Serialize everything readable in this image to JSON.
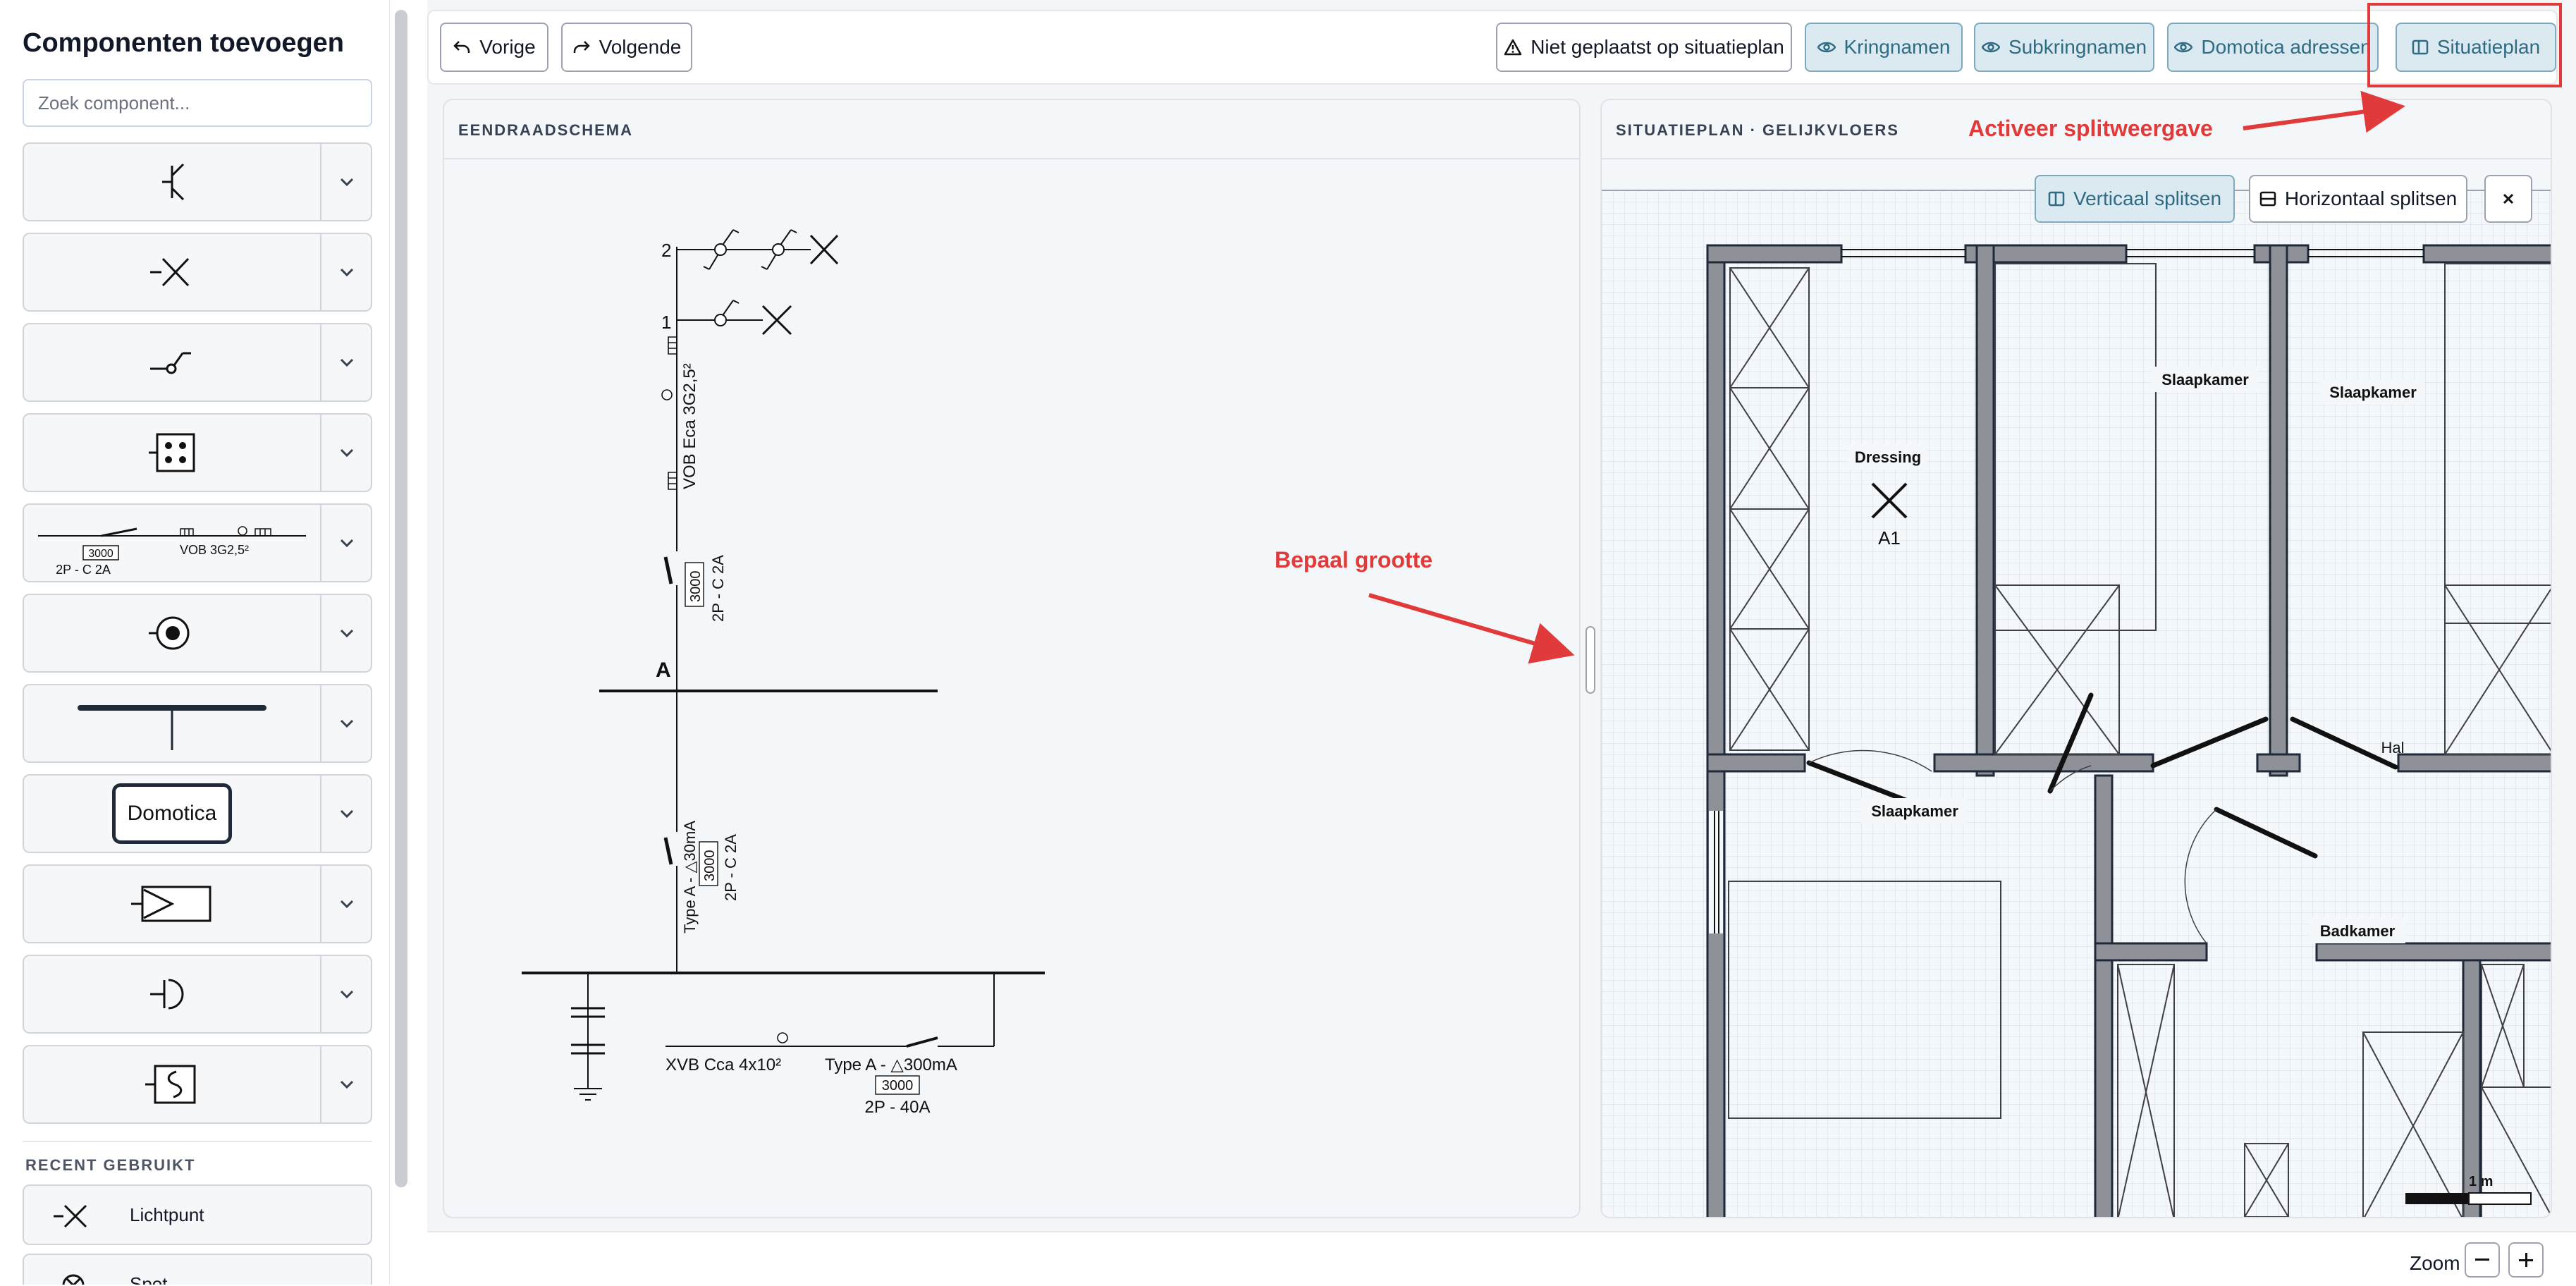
{
  "sidebar": {
    "title": "Componenten toevoegen",
    "search_placeholder": "Zoek component...",
    "components": [
      {
        "icon": "socket-switch-icon"
      },
      {
        "icon": "light-point-icon"
      },
      {
        "icon": "switch-icon"
      },
      {
        "icon": "four-point-socket-icon"
      },
      {
        "icon": "circuit-breaker-line-icon",
        "labels": {
          "rating": "3000",
          "breaker": "2P - C 2A",
          "cable": "VOB  3G2,5²"
        }
      },
      {
        "icon": "target-socket-icon"
      },
      {
        "icon": "busbar-icon"
      },
      {
        "icon": "domotica-module-icon",
        "label": "Domotica"
      },
      {
        "icon": "play-box-icon"
      },
      {
        "icon": "bell-icon"
      },
      {
        "icon": "heater-icon"
      }
    ],
    "recent_heading": "RECENT GEBRUIKT",
    "recent": [
      {
        "label": "Lichtpunt",
        "icon": "light-point-icon"
      },
      {
        "label": "Spot",
        "icon": "spot-icon"
      }
    ]
  },
  "toolbar": {
    "prev_label": "Vorige",
    "next_label": "Volgende",
    "not_placed_label": "Niet geplaatst op situatieplan",
    "circuit_names_label": "Kringnamen",
    "subcircuit_names_label": "Subkringnamen",
    "domotica_label": "Domotica adressen",
    "situatieplan_label": "Situatieplan"
  },
  "left_panel": {
    "title": "EENDRAADSCHEMA",
    "diagram": {
      "row2": "2",
      "row1": "1",
      "cable_upper": "VOB Eca 3G2,5²",
      "rating_upper": "3000",
      "breaker_upper": "2P - C 2A",
      "busbar_label": "A",
      "rcd_label": "Type A - △30mA",
      "rating_mid": "3000",
      "breaker_mid": "2P - C 2A",
      "cable_lower": "XVB Cca 4x10²",
      "rcd_main": "Type A - △300mA",
      "rating_main": "3000",
      "breaker_main": "2P - 40A"
    }
  },
  "right_panel": {
    "title": "SITUATIEPLAN · GELIJKVLOERS",
    "split_vertical": "Verticaal splitsen",
    "split_horizontal": "Horizontaal splitsen",
    "rooms": {
      "dressing": "Dressing",
      "light_id": "A1",
      "bedroom_1": "Slaapkamer",
      "bedroom_2": "Slaapkamer",
      "bedroom_3": "Slaapkamer",
      "hall": "Hal",
      "bathroom": "Badkamer",
      "scale": "1 m"
    }
  },
  "annotations": {
    "split_view": "Activeer splitweergave",
    "resize": "Bepaal grootte",
    "color": "#e03a3a"
  },
  "zoom": {
    "label": "Zoom"
  }
}
